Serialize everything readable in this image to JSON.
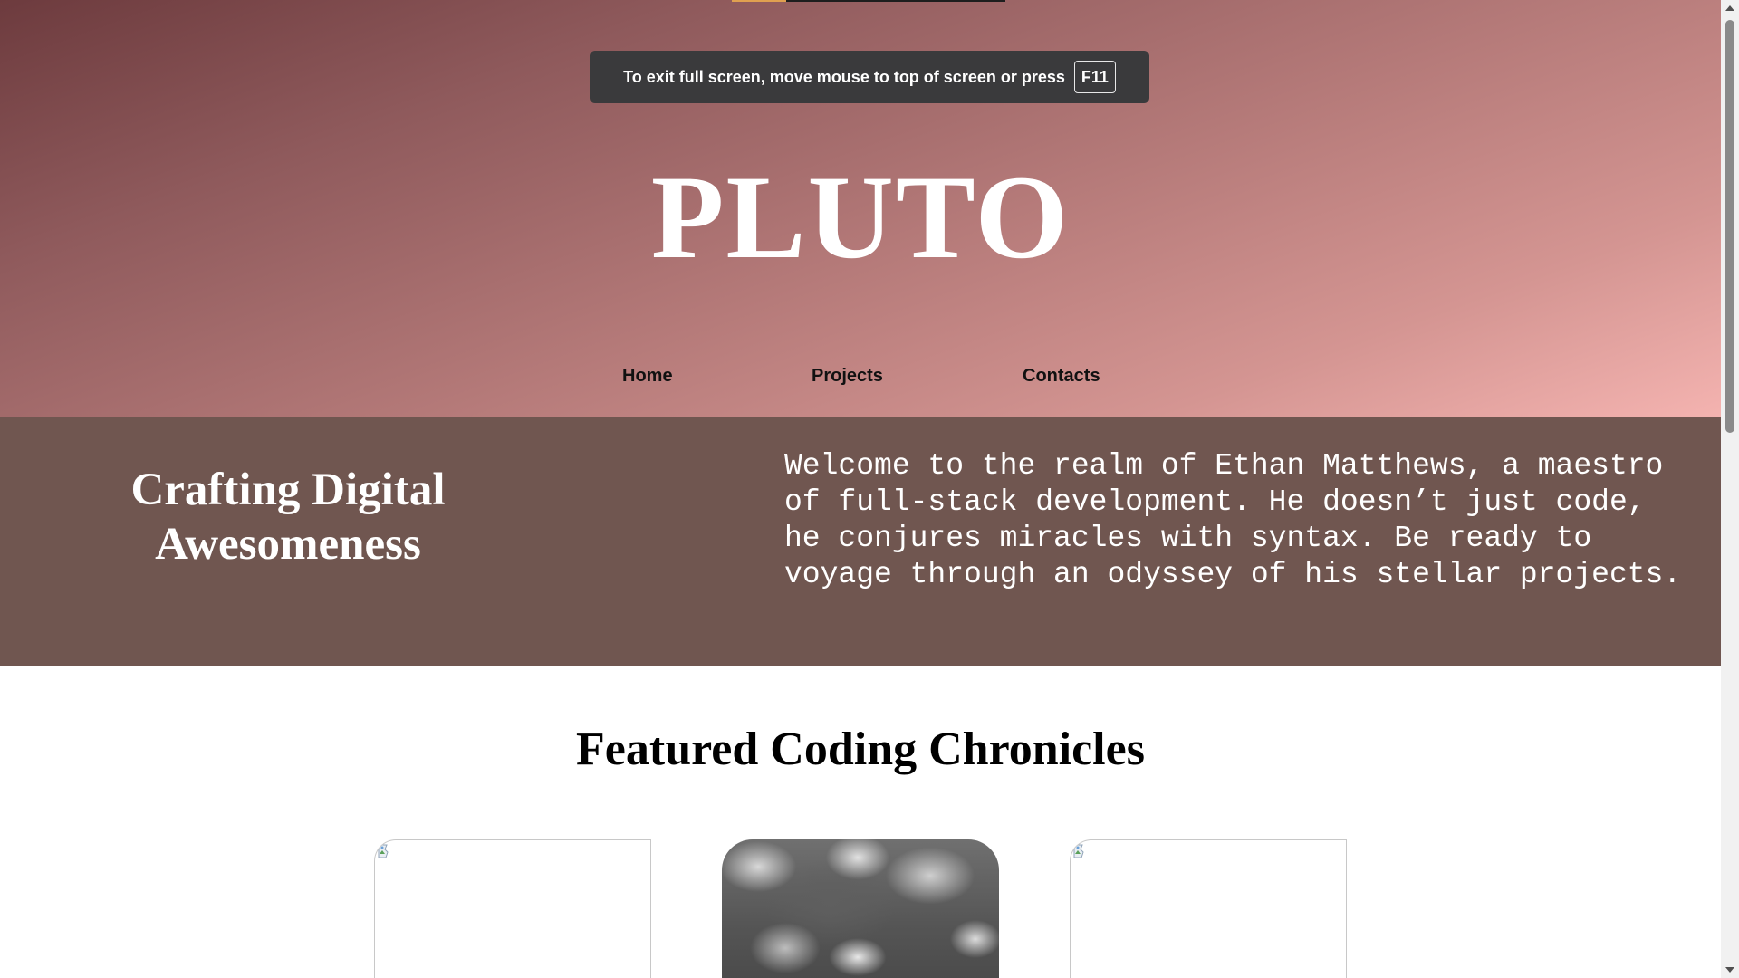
{
  "fullscreen_notice": {
    "message": "To exit full screen, move mouse to top of screen or press",
    "key": "F11",
    "progress": 0.2
  },
  "header": {
    "brand": "PLUTO",
    "nav": [
      "Home",
      "Projects",
      "Contacts"
    ]
  },
  "intro": {
    "heading": "Crafting Digital Awesomeness",
    "text": "Welcome to the realm of Ethan Matthews, a maestro of full-stack development. He doesn’t just code, he conjures miracles with syntax. Be ready to voyage through an odyssey of his stellar projects."
  },
  "featured": {
    "title": "Featured Coding Chronicles",
    "cards": [
      {
        "image": "broken-image-icon"
      },
      {
        "image": "cloud-photo"
      },
      {
        "image": "broken-image-icon"
      }
    ]
  },
  "colors": {
    "intro_band": "#705650",
    "header_gradient_start": "#6d3b3e",
    "header_gradient_end": "#f4b3b0",
    "toast_background": "#3a3a3c"
  },
  "icons": {
    "scroll_up": "triangle-up-icon",
    "scroll_down": "triangle-down-icon"
  }
}
